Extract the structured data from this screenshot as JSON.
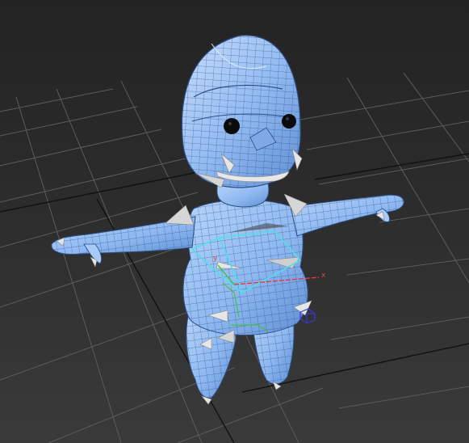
{
  "viewport": {
    "background_top": "#232323",
    "background_bottom": "#3a3a3a",
    "grid_color": "#5b5b5b",
    "grid_major_color": "#111111",
    "mesh_fill": "#8fb9f1",
    "mesh_wire": "#2c4f86",
    "mesh_highlight": "#c6ddfb",
    "selection_color": "#4fe0e8"
  },
  "gizmo": {
    "x_label": "x",
    "y_label": "y",
    "x_color": "#e03a3a",
    "y_color": "#3ec83e",
    "z_color": "#3a3ad8"
  },
  "icons": [
    "transform-gizmo-icon",
    "view-cube-icon"
  ]
}
